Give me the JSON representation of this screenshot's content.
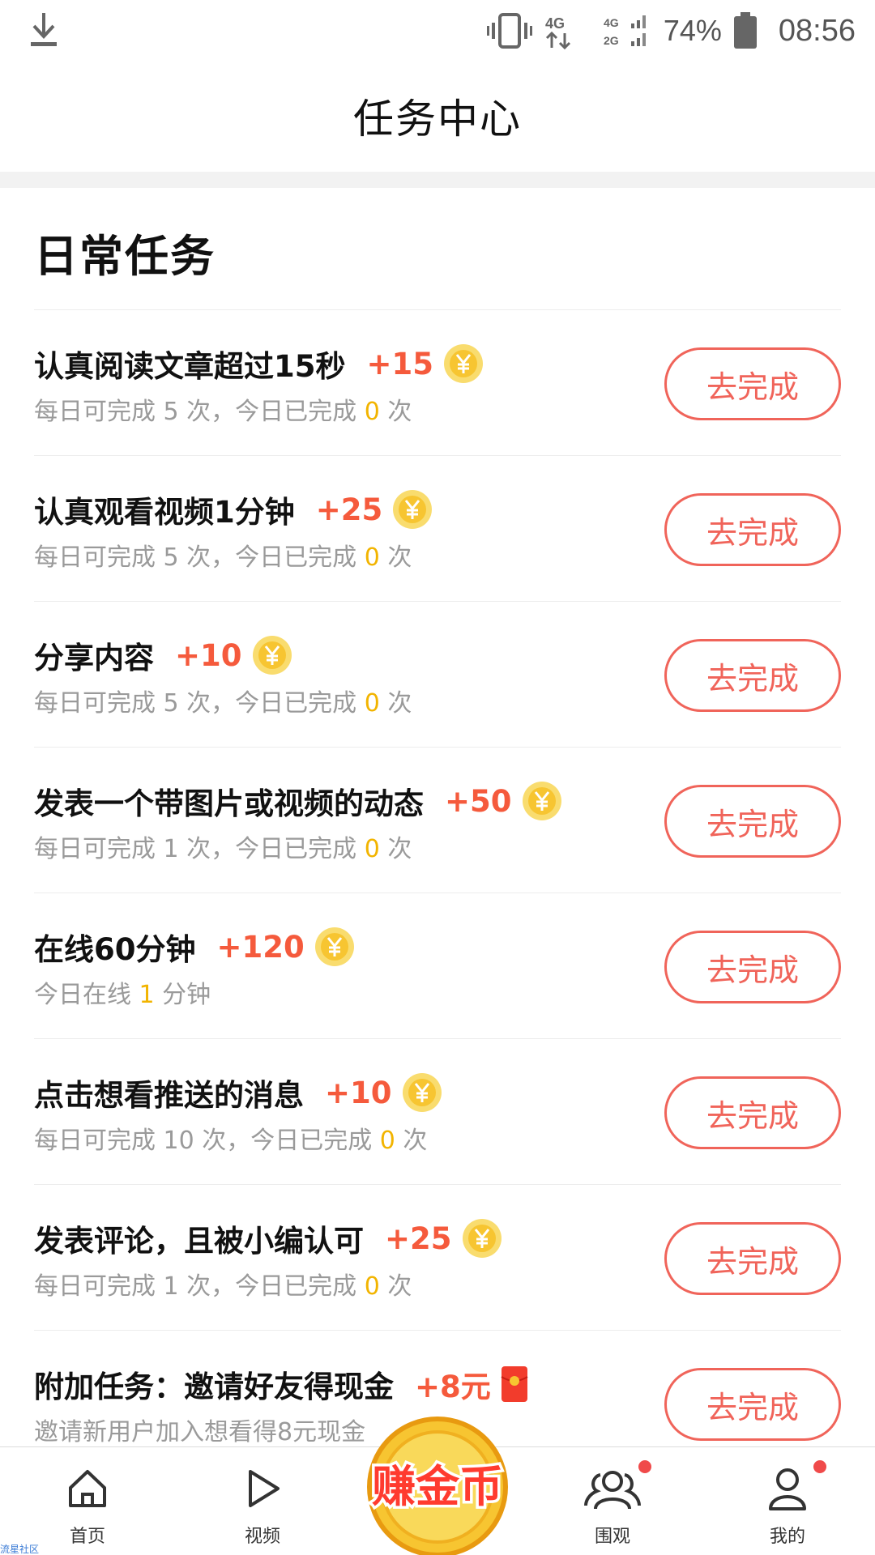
{
  "status_bar": {
    "battery_percent": "74%",
    "time": "08:56",
    "icons": [
      "download-icon",
      "vibrate-icon",
      "signal-4g-icon",
      "signal-4g-2g-icon",
      "battery-icon"
    ]
  },
  "header": {
    "title": "任务中心"
  },
  "section": {
    "title": "日常任务"
  },
  "action_label": "去完成",
  "tasks": [
    {
      "name": "认真阅读文章超过15秒",
      "reward": "+15",
      "reward_icon": "coin-icon",
      "pre": "每日可完成 5 次，今日已完成 ",
      "count": "0",
      "post": " 次"
    },
    {
      "name": "认真观看视频1分钟",
      "reward": "+25",
      "reward_icon": "coin-icon",
      "pre": "每日可完成 5 次，今日已完成 ",
      "count": "0",
      "post": " 次"
    },
    {
      "name": "分享内容",
      "reward": "+10",
      "reward_icon": "coin-icon",
      "pre": "每日可完成 5 次，今日已完成 ",
      "count": "0",
      "post": " 次"
    },
    {
      "name": "发表一个带图片或视频的动态",
      "reward": "+50",
      "reward_icon": "coin-icon",
      "pre": "每日可完成 1 次，今日已完成 ",
      "count": "0",
      "post": " 次"
    },
    {
      "name": "在线60分钟",
      "reward": "+120",
      "reward_icon": "coin-icon",
      "pre": "今日在线 ",
      "count": "1",
      "post": " 分钟"
    },
    {
      "name": "点击想看推送的消息",
      "reward": "+10",
      "reward_icon": "coin-icon",
      "pre": "每日可完成 10 次，今日已完成 ",
      "count": "0",
      "post": " 次"
    },
    {
      "name": "发表评论，且被小编认可",
      "reward": "+25",
      "reward_icon": "coin-icon",
      "pre": "每日可完成 1 次，今日已完成 ",
      "count": "0",
      "post": " 次"
    },
    {
      "name": "附加任务：邀请好友得现金",
      "reward": "+8元",
      "reward_icon": "red-packet-icon",
      "pre": "邀请新用户加入想看得8元现金",
      "count": "",
      "post": ""
    }
  ],
  "bottom_nav": {
    "items": [
      {
        "label": "首页",
        "icon": "home-icon",
        "dot": false
      },
      {
        "label": "视频",
        "icon": "play-icon",
        "dot": false
      },
      {
        "label": "围观",
        "icon": "group-icon",
        "dot": true
      },
      {
        "label": "我的",
        "icon": "user-icon",
        "dot": true
      }
    ],
    "earn_button": "赚金币"
  },
  "watermark": "流星社区",
  "colors": {
    "accent": "#f0645a",
    "reward": "#f55a3c",
    "highlight": "#f2b400",
    "coin": "#f7c531"
  }
}
